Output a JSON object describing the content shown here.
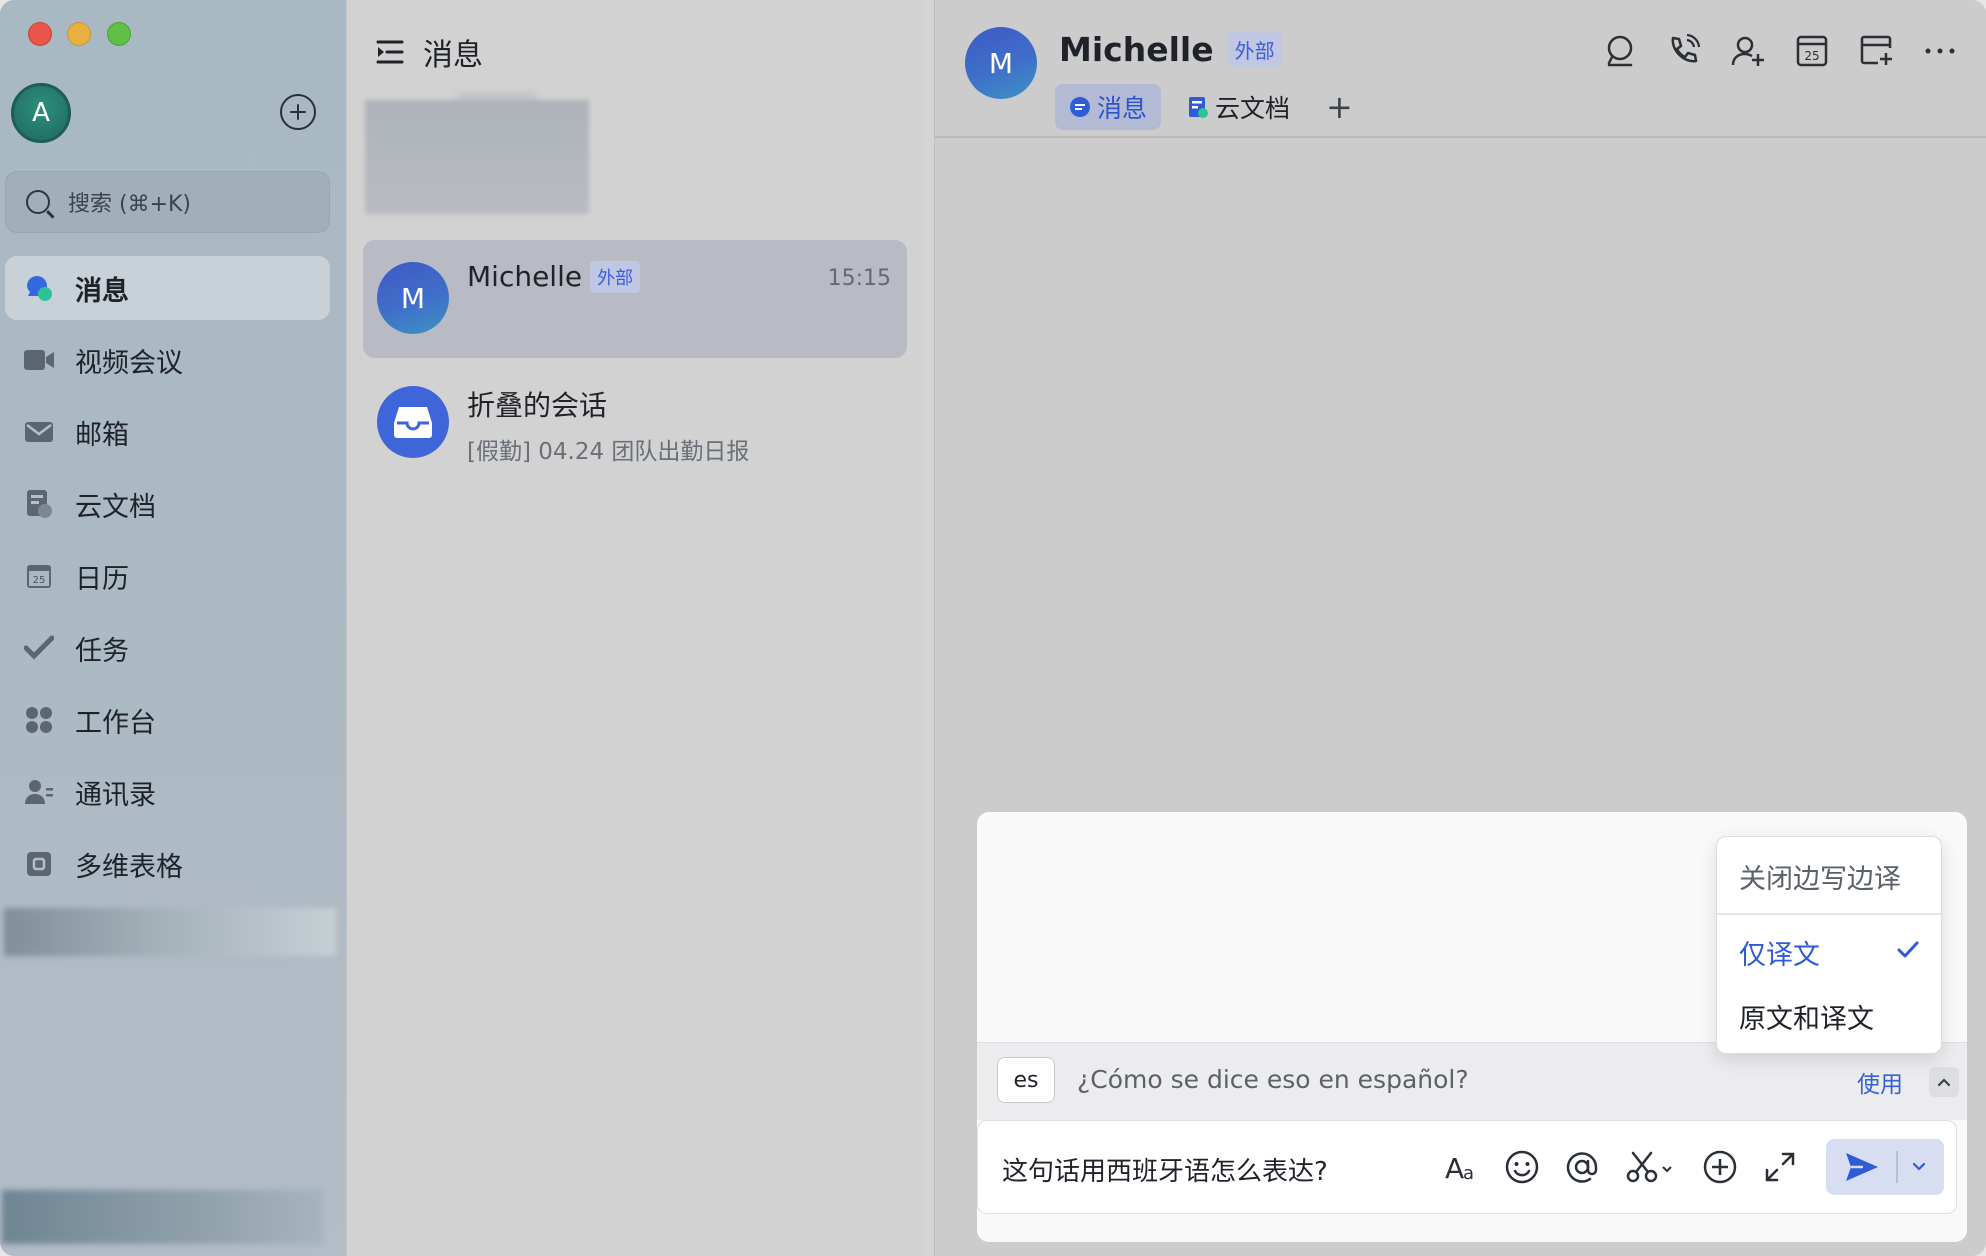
{
  "sidebar": {
    "user_avatar_letter": "A",
    "search_placeholder": "搜索 (⌘+K)",
    "items": [
      {
        "label": "消息",
        "icon": "chat-bubble-icon",
        "active": true
      },
      {
        "label": "视频会议",
        "icon": "video-camera-icon"
      },
      {
        "label": "邮箱",
        "icon": "mail-icon"
      },
      {
        "label": "云文档",
        "icon": "cloud-doc-icon"
      },
      {
        "label": "日历",
        "icon": "calendar-icon"
      },
      {
        "label": "任务",
        "icon": "task-check-icon"
      },
      {
        "label": "工作台",
        "icon": "workbench-grid-icon"
      },
      {
        "label": "通讯录",
        "icon": "contacts-icon"
      },
      {
        "label": "多维表格",
        "icon": "base-table-icon"
      }
    ]
  },
  "list": {
    "title": "消息",
    "conversations": [
      {
        "avatar_letter": "M",
        "name": "Michelle",
        "tag": "外部",
        "time": "15:15",
        "selected": true
      },
      {
        "name": "折叠的会话",
        "preview": "[假勤] 04.24 团队出勤日报",
        "icon": "inbox-tray-icon"
      }
    ]
  },
  "chat": {
    "avatar_letter": "M",
    "name": "Michelle",
    "tag": "外部",
    "header_icons": [
      "search-chat-icon",
      "phone-call-icon",
      "add-member-icon",
      "calendar-25-icon",
      "new-window-icon",
      "more-icon"
    ],
    "calendar_day": "25",
    "tabs": [
      {
        "label": "消息",
        "icon": "chat-bubble-icon",
        "active": true
      },
      {
        "label": "云文档",
        "icon": "cloud-doc-icon"
      }
    ],
    "add_tab": "+",
    "composer": {
      "language_code": "es",
      "translation": "¿Cómo se dice eso en español?",
      "use_label": "使用",
      "input_text": "这句话用西班牙语怎么表达?",
      "tools": [
        "font-format-icon",
        "emoji-icon",
        "mention-icon",
        "scissors-icon",
        "plus-circle-icon",
        "expand-icon",
        "send-icon"
      ]
    },
    "translate_menu": {
      "off_label": "关闭边写边译",
      "only_label": "仅译文",
      "both_label": "原文和译文",
      "selected": "仅译文"
    }
  },
  "colors": {
    "accent": "#2e5bd6",
    "external_tag_text": "#3a5fd6",
    "avatar_gradient_start": "#3e59c7",
    "avatar_gradient_end": "#3e93c4"
  }
}
